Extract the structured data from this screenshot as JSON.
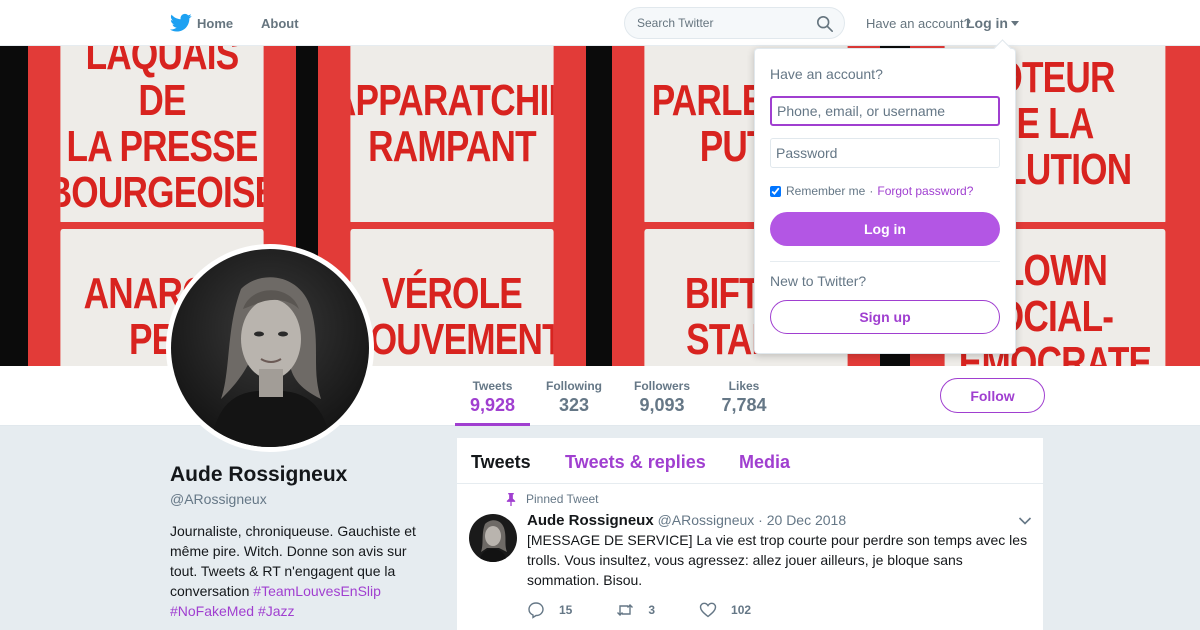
{
  "topbar": {
    "home_label": "Home",
    "about_label": "About",
    "search_placeholder": "Search Twitter",
    "have_account": "Have an account?",
    "login_label": "Log in"
  },
  "banner": {
    "signs": [
      [
        "LAQUAIS DE",
        "LA PRESSE",
        "BOURGEOISE"
      ],
      [
        "APPARATCHIK",
        "RAMPANT"
      ],
      [
        "PARLEMEN",
        "PUTR"
      ],
      [
        "OTEUR",
        "E LA",
        "OLUTION"
      ],
      [
        "ANARCHI",
        "PET"
      ],
      [
        "VÉROLE",
        "MOUVEMENT"
      ],
      [
        "BIFTEC",
        "STALIN"
      ],
      [
        "LOWN",
        "OCIAL-",
        "ÉMOCRATE"
      ]
    ]
  },
  "stats": [
    {
      "label": "Tweets",
      "value": "9,928"
    },
    {
      "label": "Following",
      "value": "323"
    },
    {
      "label": "Followers",
      "value": "9,093"
    },
    {
      "label": "Likes",
      "value": "7,784"
    }
  ],
  "follow_label": "Follow",
  "profile": {
    "name": "Aude Rossigneux",
    "handle": "@ARossigneux",
    "bio": "Journaliste, chroniqueuse. Gauchiste et même pire. Witch. Donne son avis sur tout. Tweets & RT n'engagent que la conversation",
    "hashtags": [
      "#TeamLouvesEnSlip",
      "#NoFakeMed",
      "#Jazz"
    ]
  },
  "timeline": {
    "tabs": [
      "Tweets",
      "Tweets & replies",
      "Media"
    ],
    "pinned_label": "Pinned Tweet",
    "tweet": {
      "author": "Aude Rossigneux",
      "handle": "@ARossigneux",
      "separator": "·",
      "date": "20 Dec 2018",
      "text": "[MESSAGE DE SERVICE] La vie est trop courte pour perdre son temps avec les trolls. Vous insultez, vous agressez: allez jouer ailleurs, je bloque sans sommation. Bisou.",
      "replies": "15",
      "retweets": "3",
      "likes": "102"
    }
  },
  "login_dropdown": {
    "title": "Have an account?",
    "username_placeholder": "Phone, email, or username",
    "password_placeholder": "Password",
    "remember_label": "Remember me",
    "separator": "·",
    "forgot_label": "Forgot password?",
    "login_button": "Log in",
    "new_label": "New to Twitter?",
    "signup_button": "Sign up"
  },
  "colors": {
    "accent": "#a03fd0",
    "login_button": "#b356e4",
    "sign_red": "#e23b38"
  }
}
